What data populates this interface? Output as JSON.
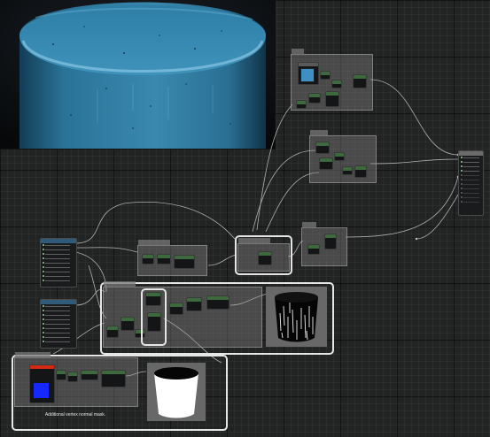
{
  "material_graph": {
    "comments": {
      "vertex_mask_caption": "Additional vertex normal mask."
    }
  },
  "colors": {
    "canvas": "#222323",
    "wire": "#bfbfbf",
    "selection": "#e6e6e6",
    "viewport_mesh": "#2b6e90",
    "texture_blue": "#1428ff",
    "texture_red": "#d42a14",
    "preview_bg": "#686868"
  },
  "icons": {
    "preview_cylinder_dark": "cylinder-noise-preview-icon",
    "preview_cylinder_white": "cylinder-mask-preview-icon",
    "texture_sample": "texture-sample-icon"
  }
}
